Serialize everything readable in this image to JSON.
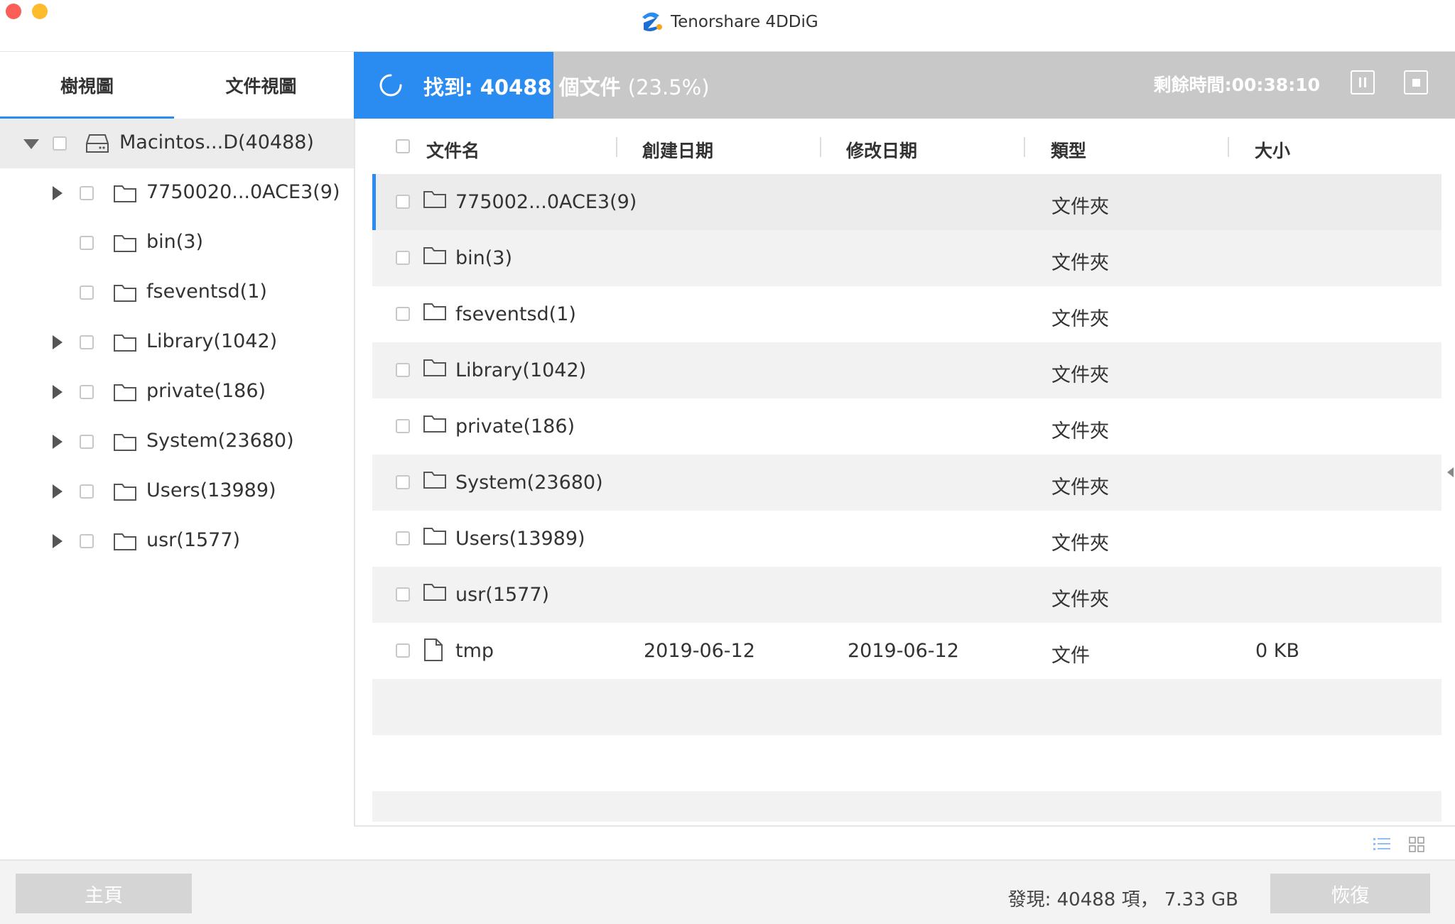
{
  "window": {
    "title": "Tenorshare 4DDiG"
  },
  "left_panel": {
    "tabs": [
      {
        "label": "樹視圖",
        "active": true
      },
      {
        "label": "文件視圖",
        "active": false
      }
    ],
    "tree": [
      {
        "label": "Macintos...D(40488)",
        "type": "drive",
        "expanded": true,
        "has_children": true
      },
      {
        "label": "7750020...0ACE3(9)",
        "type": "folder",
        "has_children": true
      },
      {
        "label": "bin(3)",
        "type": "folder",
        "has_children": false
      },
      {
        "label": "fseventsd(1)",
        "type": "folder",
        "has_children": false
      },
      {
        "label": "Library(1042)",
        "type": "folder",
        "has_children": true
      },
      {
        "label": "private(186)",
        "type": "folder",
        "has_children": true
      },
      {
        "label": "System(23680)",
        "type": "folder",
        "has_children": true
      },
      {
        "label": "Users(13989)",
        "type": "folder",
        "has_children": true
      },
      {
        "label": "usr(1577)",
        "type": "folder",
        "has_children": true
      }
    ]
  },
  "scan": {
    "found_label": "找到: 40488 個文件",
    "percent_label": "(23.5%)",
    "progress": 0.181,
    "remaining_label": "剩餘時間:00:38:10"
  },
  "table": {
    "columns": [
      "文件名",
      "創建日期",
      "修改日期",
      "類型",
      "大小"
    ],
    "rows": [
      {
        "icon": "folder-icon",
        "name": "775002...0ACE3(9)",
        "created": "",
        "modified": "",
        "type": "文件夾",
        "size": ""
      },
      {
        "icon": "folder-icon",
        "name": "bin(3)",
        "created": "",
        "modified": "",
        "type": "文件夾",
        "size": ""
      },
      {
        "icon": "folder-icon",
        "name": "fseventsd(1)",
        "created": "",
        "modified": "",
        "type": "文件夾",
        "size": ""
      },
      {
        "icon": "folder-icon",
        "name": "Library(1042)",
        "created": "",
        "modified": "",
        "type": "文件夾",
        "size": ""
      },
      {
        "icon": "folder-icon",
        "name": "private(186)",
        "created": "",
        "modified": "",
        "type": "文件夾",
        "size": ""
      },
      {
        "icon": "folder-icon",
        "name": "System(23680)",
        "created": "",
        "modified": "",
        "type": "文件夾",
        "size": ""
      },
      {
        "icon": "folder-icon",
        "name": "Users(13989)",
        "created": "",
        "modified": "",
        "type": "文件夾",
        "size": ""
      },
      {
        "icon": "folder-icon",
        "name": "usr(1577)",
        "created": "",
        "modified": "",
        "type": "文件夾",
        "size": ""
      },
      {
        "icon": "file-icon",
        "name": "tmp",
        "created": "2019-06-12",
        "modified": "2019-06-12",
        "type": "文件",
        "size": "0 KB"
      }
    ]
  },
  "footer": {
    "home_label": "主頁",
    "summary": "發現: 40488 項， 7.33 GB",
    "recover_label": "恢復"
  },
  "colors": {
    "accent": "#2a8cf0",
    "progress_track": "#c8c8c8",
    "disabled_button": "#d5d5d5"
  }
}
